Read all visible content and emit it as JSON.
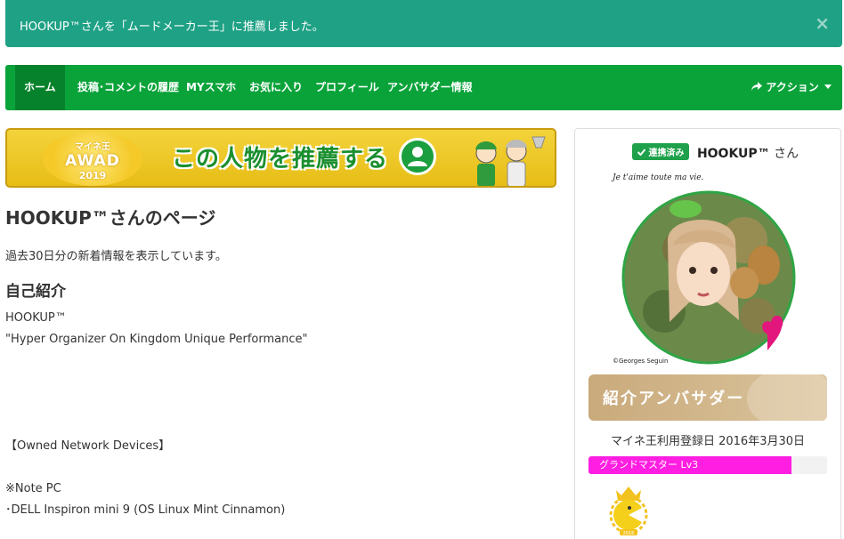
{
  "alert": {
    "message": "HOOKUP™さんを「ムードメーカー王」に推薦しました。",
    "close": "×"
  },
  "nav": {
    "items": [
      "ホーム",
      "投稿･コメントの履歴",
      "MYスマホ",
      "お気に入り",
      "プロフィール",
      "アンバサダー情報"
    ],
    "action_label": "アクション"
  },
  "banner": {
    "badge_line1": "マイネ王",
    "badge_line2": "AWAD",
    "badge_line3": "2019",
    "cta": "この人物を推薦する"
  },
  "main": {
    "title": "HOOKUP™さんのページ",
    "subtitle": "過去30日分の新着情報を表示しています。",
    "section_title": "自己紹介",
    "intro_lines": [
      "HOOKUP™",
      "\"Hyper Organizer On Kingdom Unique Performance\"",
      "【Owned Network Devices】",
      "※Note PC",
      "･DELL Inspiron mini 9 (OS Linux Mint Cinnamon)"
    ]
  },
  "sidebar": {
    "linked_badge": "連携済み",
    "username": "HOOKUP™",
    "username_suffix": "さん",
    "avatar_caption_top": "Je t'aime toute ma vie.",
    "avatar_credit": "©Georges Seguin",
    "ambassador_label": "紹介アンバサダー",
    "registration": "マイネ王利用登録日 2016年3月30日",
    "rank_label": "グランドマスター Lv3",
    "rank_progress_percent": 85,
    "medal_year": "2016"
  },
  "colors": {
    "alert": "#1ea185",
    "nav": "#0aa33a",
    "rank": "#ff1ee2"
  }
}
